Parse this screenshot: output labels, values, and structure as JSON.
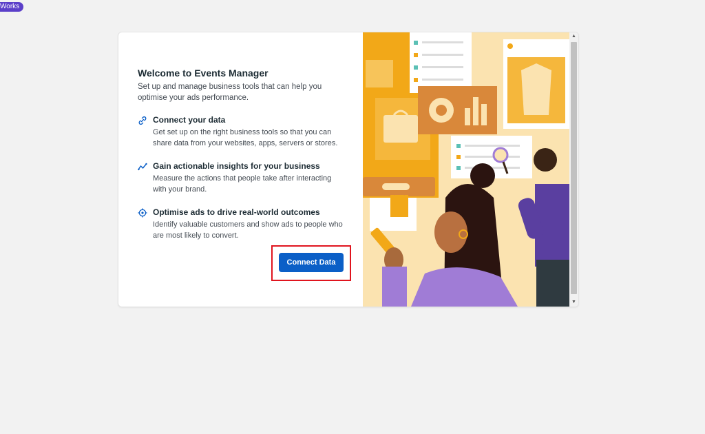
{
  "corner_badge": "Works",
  "dialog": {
    "title": "Welcome to Events Manager",
    "subtitle": "Set up and manage business tools that can help you optimise your ads performance.",
    "features": [
      {
        "icon": "link-icon",
        "heading": "Connect your data",
        "body": "Get set up on the right business tools so that you can share data from your websites, apps, servers or stores."
      },
      {
        "icon": "trend-line-icon",
        "heading": "Gain actionable insights for your business",
        "body": "Measure the actions that people take after interacting with your brand."
      },
      {
        "icon": "target-icon",
        "heading": "Optimise ads to drive real-world outcomes",
        "body": "Identify valuable customers and show ads to people who are most likely to convert."
      }
    ],
    "connect_button": "Connect Data"
  },
  "colors": {
    "primary": "#0b5fc7",
    "highlight": "#e0141e",
    "illustration_bg": "#fbe3b0",
    "accent_orange": "#f2a818",
    "accent_purple": "#7d56c2"
  }
}
